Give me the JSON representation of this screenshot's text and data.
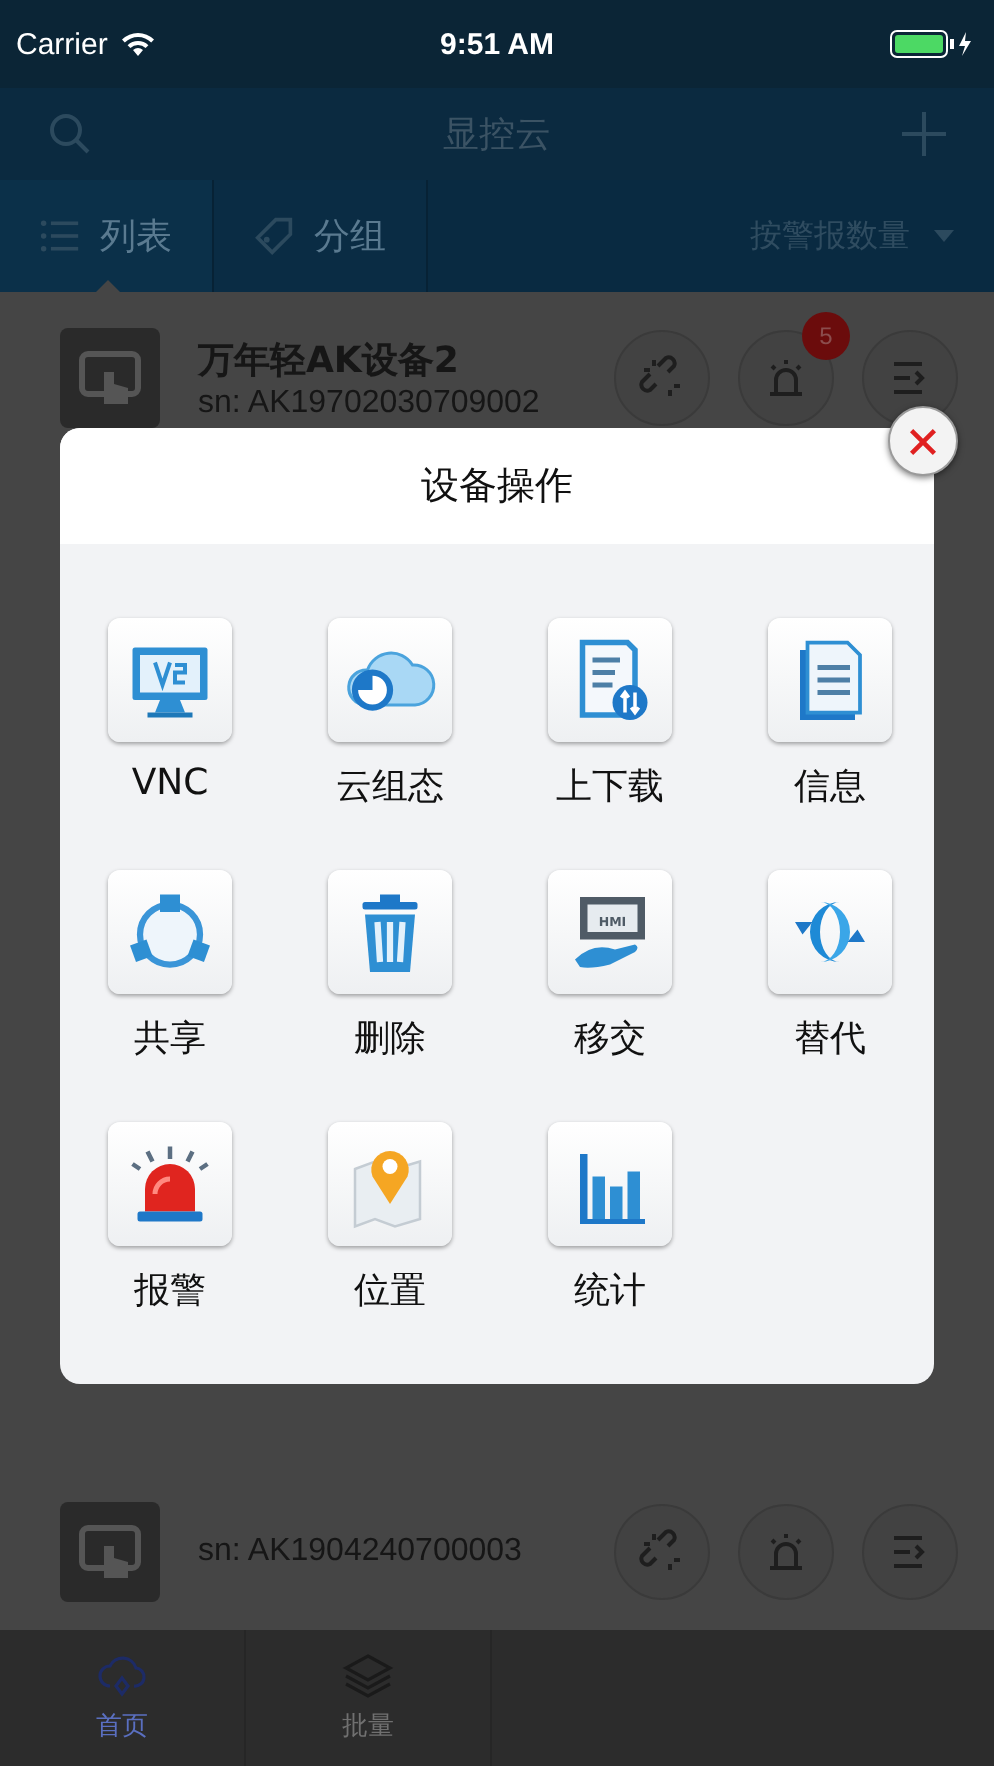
{
  "status_bar": {
    "carrier": "Carrier",
    "time": "9:51 AM"
  },
  "nav": {
    "title": "显控云"
  },
  "view_tabs": [
    {
      "label": "列表",
      "selected": true
    },
    {
      "label": "分组",
      "selected": false
    }
  ],
  "sort": {
    "label": "按警报数量"
  },
  "devices": [
    {
      "name": "万年轻AK设备2",
      "sn": "sn: AK19702030709002",
      "alarm_count": "5"
    },
    {
      "sn": "sn: AK1904240700003"
    }
  ],
  "dialog": {
    "title": "设备操作",
    "actions": [
      {
        "label": "VNC"
      },
      {
        "label": "云组态"
      },
      {
        "label": "上下载"
      },
      {
        "label": "信息"
      },
      {
        "label": "共享"
      },
      {
        "label": "删除"
      },
      {
        "label": "移交",
        "icon_text": "HMI"
      },
      {
        "label": "替代"
      },
      {
        "label": "报警"
      },
      {
        "label": "位置"
      },
      {
        "label": "统计"
      }
    ]
  },
  "bottom_tabs": [
    {
      "label": "首页",
      "selected": true
    },
    {
      "label": "批量",
      "selected": false
    }
  ]
}
